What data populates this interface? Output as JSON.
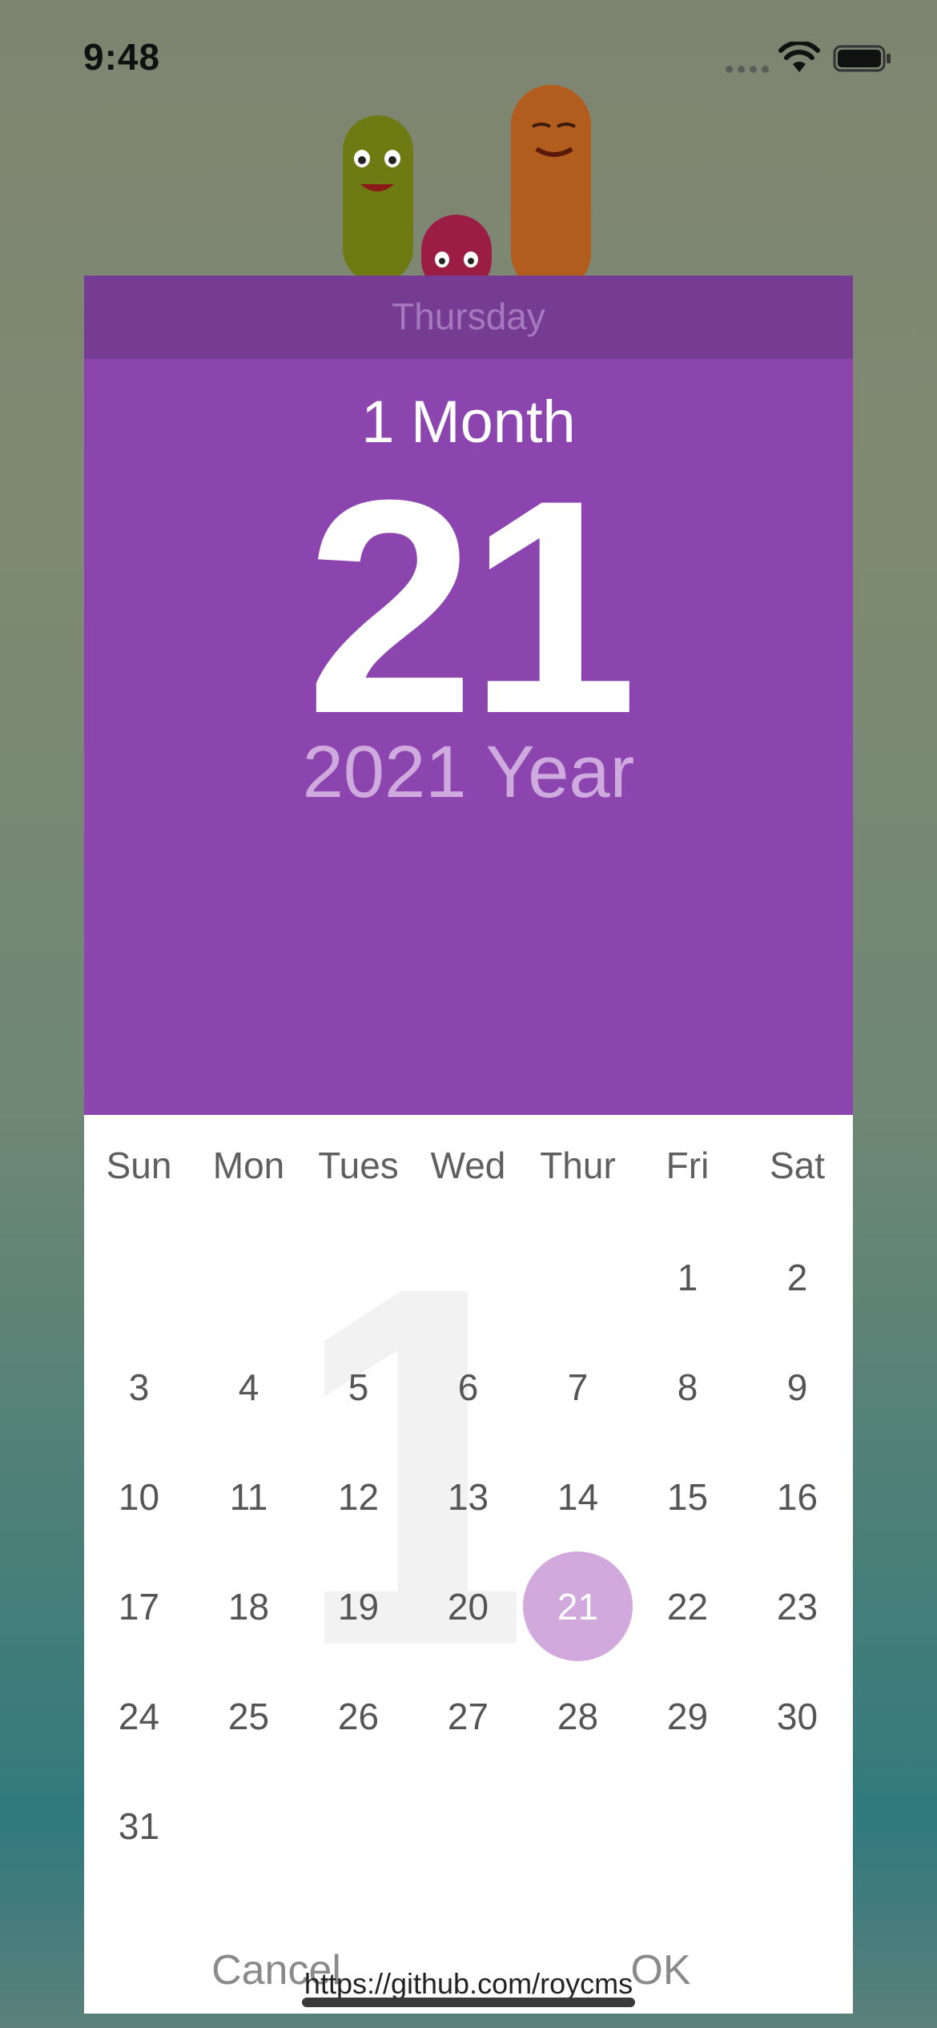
{
  "status_bar": {
    "time": "9:48"
  },
  "dialog": {
    "weekday": "Thursday",
    "month": "1 Month",
    "day": "21",
    "year": "2021 Year",
    "watermark": "1",
    "day_names": [
      "Sun",
      "Mon",
      "Tues",
      "Wed",
      "Thur",
      "Fri",
      "Sat"
    ],
    "weeks": [
      [
        "",
        "",
        "",
        "",
        "",
        "1",
        "2"
      ],
      [
        "3",
        "4",
        "5",
        "6",
        "7",
        "8",
        "9"
      ],
      [
        "10",
        "11",
        "12",
        "13",
        "14",
        "15",
        "16"
      ],
      [
        "17",
        "18",
        "19",
        "20",
        "21",
        "22",
        "23"
      ],
      [
        "24",
        "25",
        "26",
        "27",
        "28",
        "29",
        "30"
      ],
      [
        "31",
        "",
        "",
        "",
        "",
        "",
        ""
      ]
    ],
    "selected_day": "21",
    "cancel_label": "Cancel",
    "ok_label": "OK"
  },
  "footer": {
    "link": "https://github.com/roycms"
  },
  "colors": {
    "header": "#8c45af",
    "weekday_bar": "#763c93",
    "selected": "#d2a9dc",
    "year_text": "#cfaade"
  }
}
